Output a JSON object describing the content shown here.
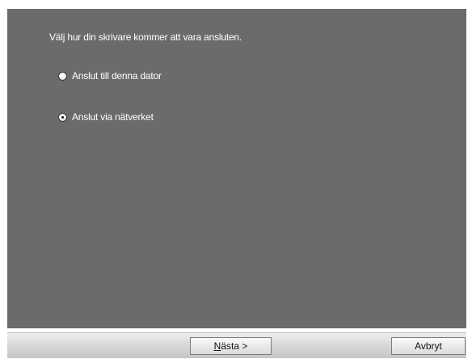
{
  "wizard": {
    "instruction": "Välj hur din skrivare kommer att vara ansluten."
  },
  "options": [
    {
      "label": "Anslut till denna dator",
      "selected": false
    },
    {
      "label": "Anslut via nätverket",
      "selected": true
    }
  ],
  "buttons": {
    "next_mnemonic": "N",
    "next_rest": "ästa >",
    "cancel_label": "Avbryt"
  }
}
